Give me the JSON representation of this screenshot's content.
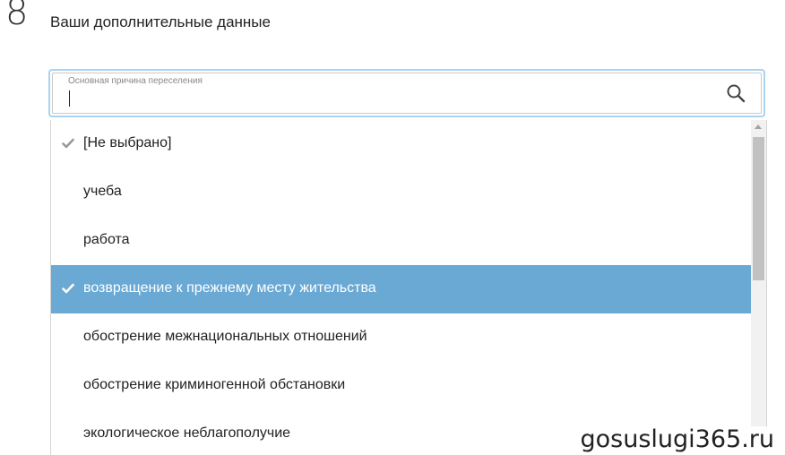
{
  "section": {
    "number": "8",
    "title": "Ваши дополнительные данные"
  },
  "field": {
    "label": "Основная причина переселения",
    "value": ""
  },
  "options": [
    {
      "label": "[Не выбрано]",
      "checked": true,
      "highlighted": false
    },
    {
      "label": "учеба",
      "checked": false,
      "highlighted": false
    },
    {
      "label": "работа",
      "checked": false,
      "highlighted": false
    },
    {
      "label": "возвращение к прежнему месту жительства",
      "checked": true,
      "highlighted": true
    },
    {
      "label": "обострение межнациональных отношений",
      "checked": false,
      "highlighted": false
    },
    {
      "label": "обострение криминогенной обстановки",
      "checked": false,
      "highlighted": false
    },
    {
      "label": "экологическое неблагополучие",
      "checked": false,
      "highlighted": false
    }
  ],
  "watermark": "gosuslugi365.ru",
  "icons": {
    "search": "search-icon",
    "check": "check-icon"
  },
  "colors": {
    "highlight": "#6aa9d4",
    "field_focus_border": "#a9d3f2",
    "check_gray": "#999999"
  }
}
